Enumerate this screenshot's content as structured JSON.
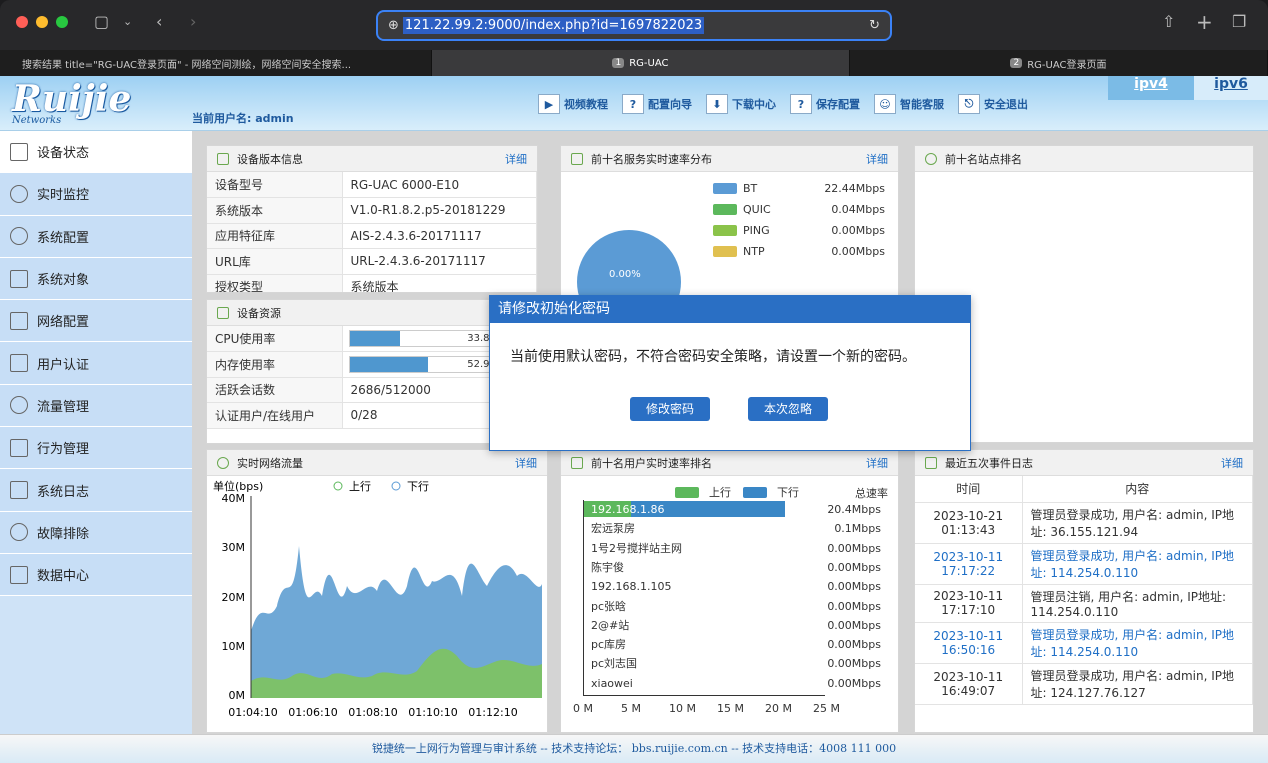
{
  "browser": {
    "url": "121.22.99.2:9000/index.php?id=1697822023",
    "tabs": [
      {
        "num": "",
        "label": "搜索结果 title=\"RG-UAC登录页面\" - 网络空间测绘，网络空间安全搜索..."
      },
      {
        "num": "1",
        "label": "RG-UAC"
      },
      {
        "num": "2",
        "label": "RG-UAC登录页面"
      }
    ]
  },
  "header": {
    "logo": "Ruijie",
    "logo_sub": "Networks",
    "user": "当前用户名: admin",
    "toolbar": [
      "视频教程",
      "配置向导",
      "下载中心",
      "保存配置",
      "智能客服",
      "安全退出"
    ],
    "ip_tabs": [
      "ipv4",
      "ipv6"
    ]
  },
  "sidebar": [
    "设备状态",
    "实时监控",
    "系统配置",
    "系统对象",
    "网络配置",
    "用户认证",
    "流量管理",
    "行为管理",
    "系统日志",
    "故障排除",
    "数据中心"
  ],
  "device_info": {
    "title": "设备版本信息",
    "more": "详细",
    "rows": [
      [
        "设备型号",
        "RG-UAC 6000-E10"
      ],
      [
        "系统版本",
        "V1.0-R1.8.2.p5-20181229"
      ],
      [
        "应用特征库",
        "AIS-2.4.3.6-20171117"
      ],
      [
        "URL库",
        "URL-2.4.3.6-20171117"
      ],
      [
        "授权类型",
        "系统版本"
      ]
    ]
  },
  "resources": {
    "title": "设备资源",
    "cpu_label": "CPU使用率",
    "cpu": 33.8,
    "mem_label": "内存使用率",
    "mem": 52.9,
    "sess_label": "活跃会话数",
    "sess": "2686/512000",
    "auth_label": "认证用户/在线用户",
    "auth": "0/28"
  },
  "service_rate": {
    "title": "前十名服务实时速率分布",
    "more": "详细",
    "pie_label": "0.00%",
    "colors": {
      "BT": "#5b9bd5",
      "QUIC": "#5cb85c",
      "PING": "#8bc34a",
      "NTP": "#e0c050"
    },
    "items": [
      [
        "BT",
        "22.44Mbps"
      ],
      [
        "QUIC",
        "0.04Mbps"
      ],
      [
        "PING",
        "0.00Mbps"
      ],
      [
        "NTP",
        "0.00Mbps"
      ]
    ]
  },
  "site_rank": {
    "title": "前十名站点排名"
  },
  "traffic": {
    "title": "实时网络流量",
    "more": "详细",
    "unit": "单位(bps)",
    "legend_up": "上行",
    "legend_down": "下行",
    "yticks": [
      "40M",
      "30M",
      "20M",
      "10M",
      "0M"
    ],
    "xticks": [
      "01:04:10",
      "01:06:10",
      "01:08:10",
      "01:10:10",
      "01:12:10"
    ]
  },
  "user_rank": {
    "title": "前十名用户实时速率排名",
    "more": "详细",
    "legend_up": "上行",
    "legend_down": "下行",
    "total_label": "总速率",
    "rows": [
      [
        "192.168.1.86",
        "20.4Mbps"
      ],
      [
        "宏远泵房",
        "0.1Mbps"
      ],
      [
        "1号2号搅拌站主网",
        "0.00Mbps"
      ],
      [
        "陈宇俊",
        "0.00Mbps"
      ],
      [
        "192.168.1.105",
        "0.00Mbps"
      ],
      [
        "pc张晗",
        "0.00Mbps"
      ],
      [
        "2@#站",
        "0.00Mbps"
      ],
      [
        "pc库房",
        "0.00Mbps"
      ],
      [
        "pc刘志国",
        "0.00Mbps"
      ],
      [
        "xiaowei",
        "0.00Mbps"
      ]
    ],
    "xticks": [
      "0 M",
      "5 M",
      "10 M",
      "15 M",
      "20 M",
      "25 M"
    ]
  },
  "events": {
    "title": "最近五次事件日志",
    "more": "详细",
    "col_time": "时间",
    "col_content": "内容",
    "rows": [
      [
        "2023-10-21 01:13:43",
        "管理员登录成功, 用户名: admin, IP地址: 36.155.121.94"
      ],
      [
        "2023-10-11 17:17:22",
        "管理员登录成功, 用户名: admin, IP地址: 114.254.0.110"
      ],
      [
        "2023-10-11 17:17:10",
        "管理员注销, 用户名: admin, IP地址: 114.254.0.110"
      ],
      [
        "2023-10-11 16:50:16",
        "管理员登录成功, 用户名: admin, IP地址: 114.254.0.110"
      ],
      [
        "2023-10-11 16:49:07",
        "管理员登录成功, 用户名: admin, IP地址: 124.127.76.127"
      ]
    ]
  },
  "modal": {
    "title": "请修改初始化密码",
    "message": "当前使用默认密码，不符合密码安全策略，请设置一个新的密码。",
    "btn_change": "修改密码",
    "btn_ignore": "本次忽略"
  },
  "footer": "锐捷统一上网行为管理与审计系统 -- 技术支持论坛： bbs.ruijie.com.cn -- 技术支持电话：4008 111 000"
}
